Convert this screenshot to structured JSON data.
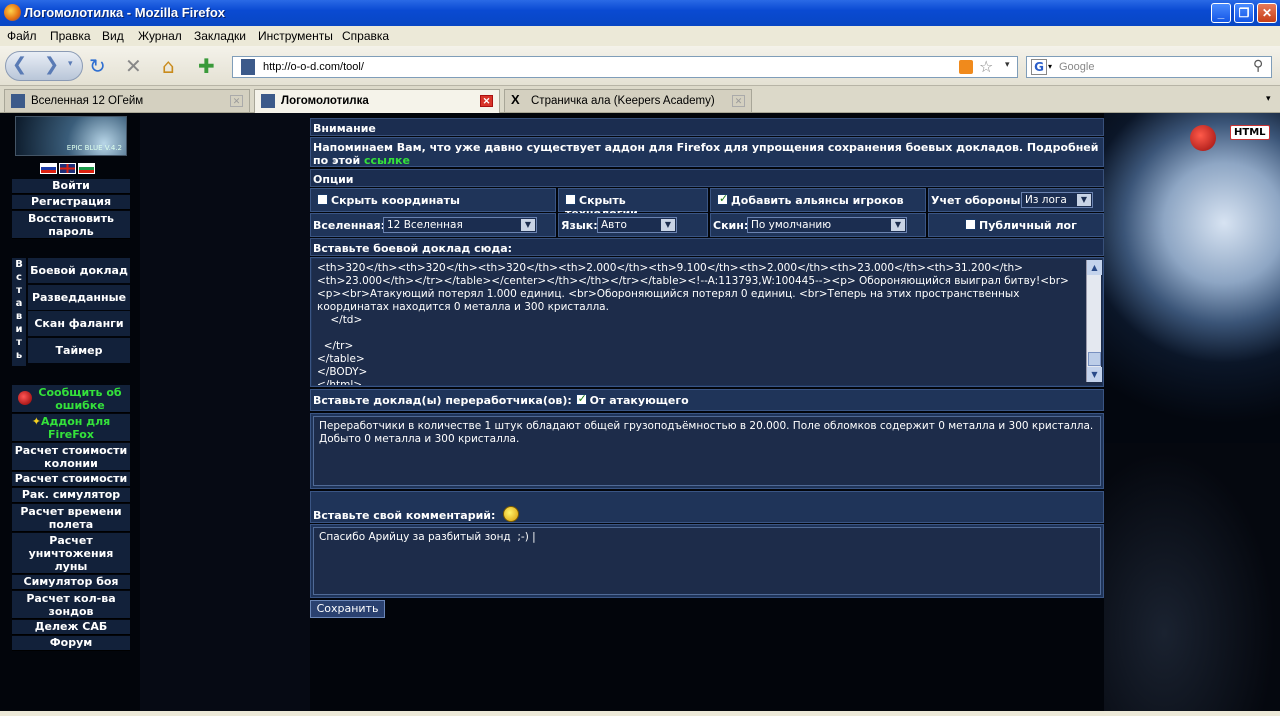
{
  "window": {
    "title": "Логомолотилка - Mozilla Firefox"
  },
  "menu": [
    "Файл",
    "Правка",
    "Вид",
    "Журнал",
    "Закладки",
    "Инструменты",
    "Справка"
  ],
  "nav": {
    "url": "http://o-o-d.com/tool/",
    "search_placeholder": "Google"
  },
  "tabs": [
    {
      "label": "Вселенная 12 ОГейм",
      "active": false
    },
    {
      "label": "Логомолотилка",
      "active": true
    },
    {
      "label": "Страничка ала (Keepers Academy)",
      "active": false
    }
  ],
  "sidebar": {
    "logo_text": "EPIC BLUE V.4.2",
    "login": "Войти",
    "register": "Регистрация",
    "restore": "Восстановить пароль",
    "vertical_letters": [
      "В",
      "с",
      "т",
      "а",
      "в",
      "и",
      "т",
      "ь"
    ],
    "actions": [
      "Боевой доклад",
      "Разведданные",
      "Скан фаланги",
      "Таймер"
    ],
    "report_bug": "Сообщить об ошибке",
    "addon": "Аддон для FireFox",
    "links": [
      "Расчет стоимости колонии",
      "Расчет стоимости",
      "Рак. симулятор",
      "Расчет времени полета",
      "Расчет уничтожения луны",
      "Симулятор боя",
      "Расчет кол-ва зондов",
      "Дележ САБ",
      "Форум"
    ]
  },
  "notice": {
    "header": "Внимание",
    "text": "Напоминаем Вам, что уже давно существует аддон для Firefox для упрощения сохранения боевых докладов. Подробней по этой",
    "link": "ссылке"
  },
  "options": {
    "header": "Опции",
    "hide_coords": {
      "label": "Скрыть координаты",
      "checked": false
    },
    "hide_tech": {
      "label": "Скрыть технологии",
      "checked": false
    },
    "add_alliances": {
      "label": "Добавить альянсы игроков",
      "checked": true
    },
    "defense_label": "Учет обороны:",
    "defense_value": "Из лога",
    "universe_label": "Вселенная:",
    "universe_value": "12 Вселенная",
    "lang_label": "Язык:",
    "lang_value": "Авто",
    "skin_label": "Скин:",
    "skin_value": "По умолчанию",
    "public_log": {
      "label": "Публичный лог",
      "checked": false
    }
  },
  "battle": {
    "header": "Вставьте боевой доклад сюда:",
    "text": "<th>320</th><th>320</th><th>320</th><th>2.000</th><th>9.100</th><th>2.000</th><th>23.000</th><th>31.200</th><th>23.000</th></tr></table></center></th></th></tr></table><!--A:113793,W:100445--><p> Обороняющийся выиграл битву!<br><p><br>Атакующий потерял 1.000 единиц. <br>Обороняющийся потерял 0 единиц. <br>Теперь на этих пространственных координатах находится 0 металла и 300 кристалла.\n    </td>\n\n  </tr>\n</table>\n</BODY>\n</html>"
  },
  "recycler": {
    "header": "Вставьте доклад(ы) переработчика(ов):",
    "from_attacker": {
      "label": "От атакующего",
      "checked": true
    },
    "text": "Переработчики в количестве 1 штук обладают общей грузоподъёмностью в 20.000. Поле обломков содержит 0 металла и 300 кристалла. Добыто 0 металла и 300 кристалла."
  },
  "comment": {
    "header": "Вставьте свой комментарий:",
    "text": "Спасибо Арийцу за разбитый зонд  ;-) |"
  },
  "save_label": "Сохранить",
  "html_badge": "HTML"
}
